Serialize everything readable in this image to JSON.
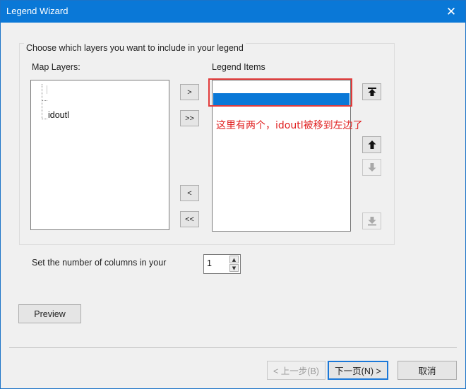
{
  "window": {
    "title": "Legend Wizard",
    "close_glyph": "✕"
  },
  "group": {
    "label": "Choose which layers you want to include in your legend"
  },
  "map_layers": {
    "label": "Map Layers:",
    "items": [
      "idoutl"
    ]
  },
  "legend_items": {
    "label": "Legend Items"
  },
  "transfer_buttons": {
    "add": ">",
    "add_all": ">>",
    "remove": "<",
    "remove_all": "<<"
  },
  "order_buttons": {
    "icons": [
      "move-to-top-icon",
      "move-up-icon",
      "move-down-icon",
      "move-to-bottom-icon"
    ]
  },
  "annotation": {
    "text": "这里有两个，idoutl被移到左边了",
    "color": "#e02020"
  },
  "columns": {
    "label": "Set the number of columns in your",
    "value": "1"
  },
  "preview_button": "Preview",
  "footer": {
    "back": "< 上一步(B)",
    "next": "下一页(N) >",
    "cancel": "取消"
  },
  "colors": {
    "title_bar": "#0a78d7",
    "selection": "#0a78d7",
    "annotation_box": "#e23b3b"
  }
}
